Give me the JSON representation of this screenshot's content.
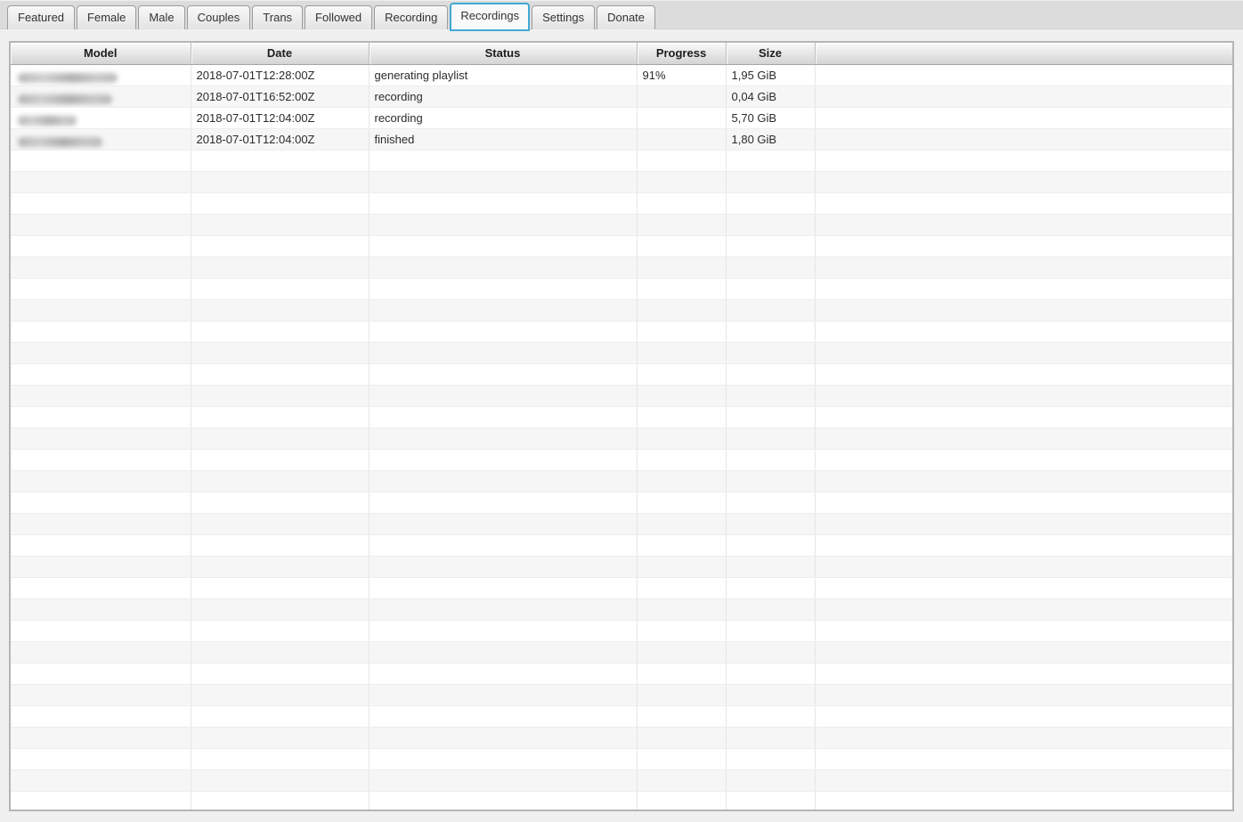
{
  "tabs": {
    "labels": [
      "Featured",
      "Female",
      "Male",
      "Couples",
      "Trans",
      "Followed",
      "Recording",
      "Recordings",
      "Settings",
      "Donate"
    ],
    "active": "Recordings"
  },
  "table": {
    "columns": [
      "Model",
      "Date",
      "Status",
      "Progress",
      "Size",
      ""
    ],
    "rows": [
      {
        "model": "",
        "model_redacted": true,
        "model_blur_width": 112,
        "date": "2018-07-01T12:28:00Z",
        "status": "generating playlist",
        "progress": "91%",
        "size": "1,95 GiB"
      },
      {
        "model": "",
        "model_redacted": true,
        "model_blur_width": 106,
        "date": "2018-07-01T16:52:00Z",
        "status": "recording",
        "progress": "",
        "size": "0,04 GiB"
      },
      {
        "model": "",
        "model_redacted": true,
        "model_blur_width": 66,
        "date": "2018-07-01T12:04:00Z",
        "status": "recording",
        "progress": "",
        "size": "5,70 GiB"
      },
      {
        "model": "",
        "model_redacted": true,
        "model_blur_width": 95,
        "date": "2018-07-01T12:04:00Z",
        "status": "finished",
        "progress": "",
        "size": "1,80 GiB"
      }
    ],
    "empty_row_count": 31
  },
  "colors": {
    "active_tab_border": "#41a9d4",
    "window_background": "#f0f0f0",
    "tabbar_background": "#dcdcdc",
    "row_alt_background": "#f6f6f6"
  }
}
